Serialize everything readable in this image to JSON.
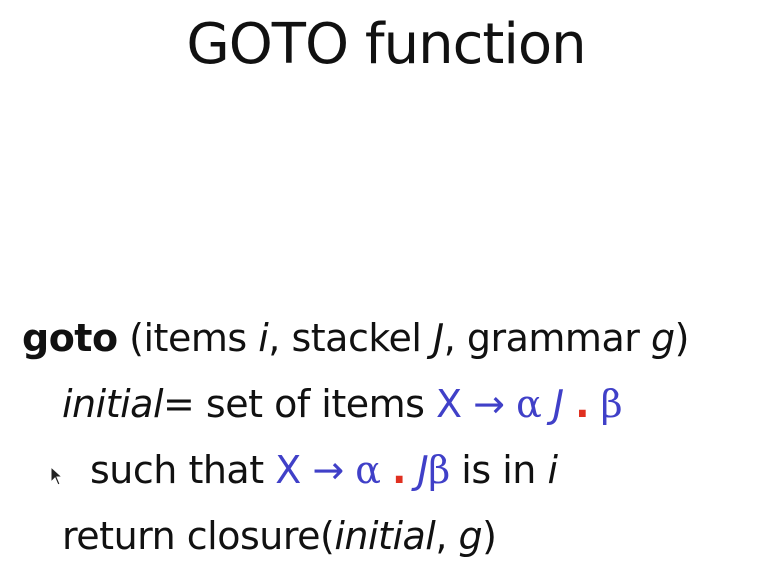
{
  "slide": {
    "title": "GOTO function",
    "line1": {
      "keyword": "goto",
      "open": " (items ",
      "param_i": "i",
      "mid1": ", stackel ",
      "param_J": "J",
      "mid2": ", grammar ",
      "param_g": "g",
      "close": ")"
    },
    "line2": {
      "var": "initial",
      "assign": "= set of items ",
      "X": "X",
      "arrow": " → ",
      "alpha": "α",
      "J": "J",
      "dot": ".",
      "beta": "β"
    },
    "line3": {
      "lead": "such that ",
      "X": "X",
      "arrow": " → ",
      "alpha": "α",
      "dot": ".",
      "J": "J",
      "beta": "β",
      "tail": " is in ",
      "i": "i"
    },
    "line4": {
      "lead": "return closure(",
      "var": "initial",
      "sep": ", ",
      "g": "g",
      "close": ")"
    }
  },
  "icons": {
    "cursor": "mouse-pointer-icon"
  }
}
